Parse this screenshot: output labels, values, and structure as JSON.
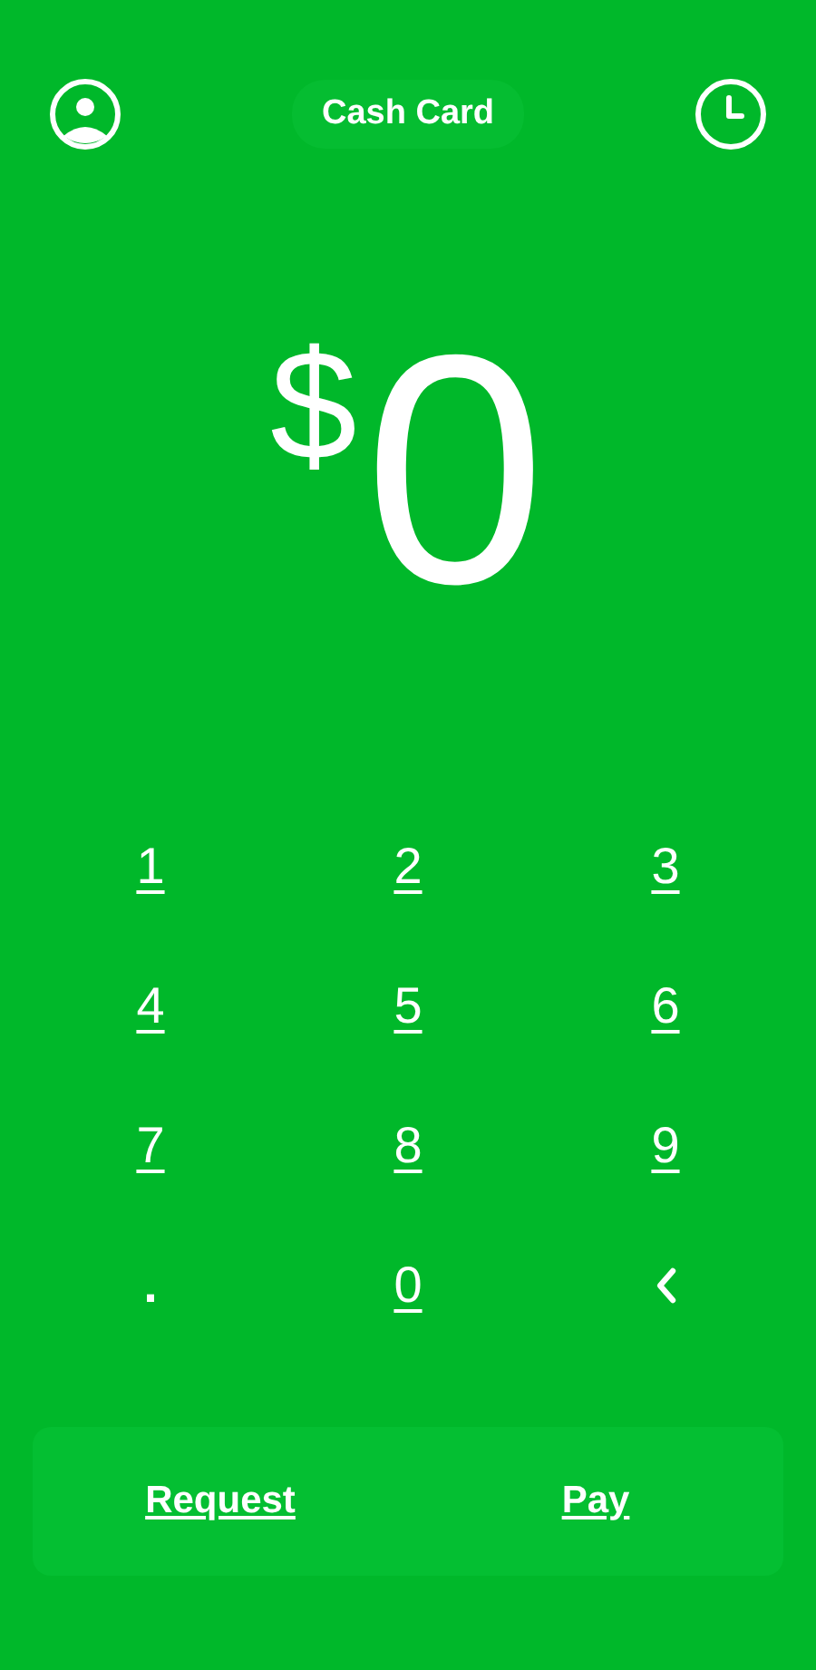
{
  "header": {
    "title": "Cash Card"
  },
  "amount": {
    "currency": "$",
    "value": "0"
  },
  "keypad": [
    {
      "kind": "digit",
      "label": "1"
    },
    {
      "kind": "digit",
      "label": "2"
    },
    {
      "kind": "digit",
      "label": "3"
    },
    {
      "kind": "digit",
      "label": "4"
    },
    {
      "kind": "digit",
      "label": "5"
    },
    {
      "kind": "digit",
      "label": "6"
    },
    {
      "kind": "digit",
      "label": "7"
    },
    {
      "kind": "digit",
      "label": "8"
    },
    {
      "kind": "digit",
      "label": "9"
    },
    {
      "kind": "dot",
      "label": "."
    },
    {
      "kind": "digit",
      "label": "0"
    },
    {
      "kind": "back"
    }
  ],
  "actions": [
    "Request",
    "Pay"
  ]
}
